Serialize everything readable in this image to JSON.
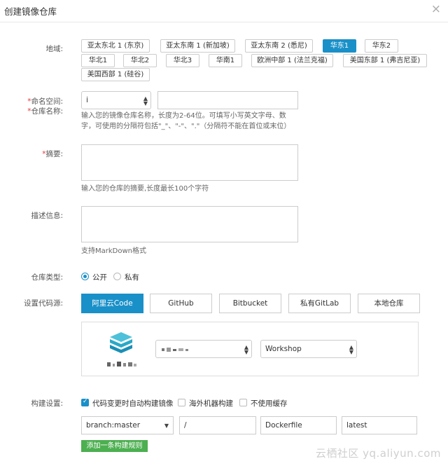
{
  "dialog": {
    "title": "创建镜像仓库",
    "close_glyph": "×"
  },
  "region": {
    "label": "地域:",
    "selected": "华东1",
    "options": [
      "亚太东北 1 (东京)",
      "亚太东南 1 (新加坡)",
      "亚太东南 2 (悉尼)",
      "华东1",
      "华东2",
      "华北1",
      "华北2",
      "华北3",
      "华南1",
      "欧洲中部 1 (法兰克福)",
      "美国东部 1 (弗吉尼亚)",
      "美国西部 1 (硅谷)"
    ]
  },
  "namespace": {
    "label": "命名空间:",
    "value": "i"
  },
  "repo_name": {
    "label": "仓库名称:",
    "value": "",
    "hint_line1": "输入您的镜像仓库名称，长度为2-64位。可填写小写英文字母、数",
    "hint_line2": "字，可使用的分隔符包括\"_\"、\"-\"、\".\"（分隔符不能在首位或末位）"
  },
  "summary": {
    "label": "摘要:",
    "value": "",
    "hint": "输入您的仓库的摘要,长度最长100个字符"
  },
  "description": {
    "label": "描述信息:",
    "value": "",
    "hint": "支持MarkDown格式"
  },
  "repo_type": {
    "label": "仓库类型:",
    "selected": "公开",
    "options": [
      "公开",
      "私有"
    ]
  },
  "code_source": {
    "label": "设置代码源:",
    "selected": "阿里云Code",
    "options": [
      "阿里云Code",
      "GitHub",
      "Bitbucket",
      "私有GitLab",
      "本地仓库"
    ],
    "account_value": "",
    "project_value": "Workshop"
  },
  "build": {
    "label": "构建设置:",
    "options": [
      {
        "label": "代码变更时自动构建镜像",
        "checked": true
      },
      {
        "label": "海外机器构建",
        "checked": false
      },
      {
        "label": "不使用缓存",
        "checked": false
      }
    ],
    "rule": {
      "branch": "branch:master",
      "directory": "/",
      "dockerfile": "Dockerfile",
      "tag": "latest"
    },
    "add_rule_label": "添加一条构建规则"
  },
  "watermark": "云栖社区 yq.aliyun.com",
  "colors": {
    "accent": "#1a90c8",
    "add_button": "#4caf50",
    "required": "#e4393c"
  }
}
